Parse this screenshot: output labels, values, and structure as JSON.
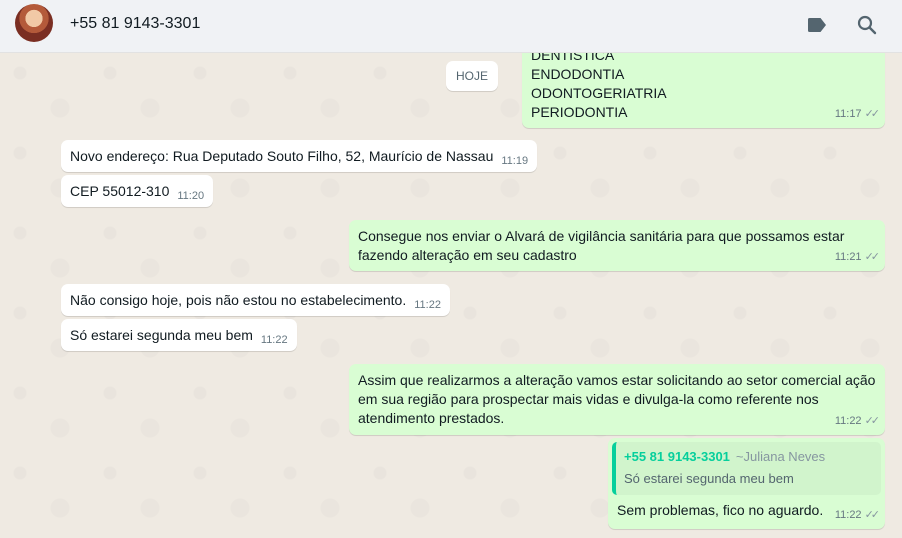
{
  "header": {
    "contact_name": "+55 81 9143-3301",
    "icons": [
      "label-icon",
      "search-icon"
    ]
  },
  "chat": {
    "day_separator": "HOJE",
    "messages": [
      {
        "dir": "out",
        "lines": [
          "DENTÍSTICA",
          "ENDODONTIA",
          "ODONTOGERIATRIA",
          "PERIODONTIA"
        ],
        "time": "11:17",
        "ticks": "✓✓"
      },
      {
        "dir": "in",
        "text": "Novo endereço: Rua Deputado Souto Filho, 52, Maurício de Nassau",
        "time": "11:19"
      },
      {
        "dir": "in",
        "text": "CEP 55012-310",
        "time": "11:20"
      },
      {
        "dir": "out",
        "text": "Consegue nos enviar o Alvará de vigilância sanitária para que possamos estar fazendo alteração em seu cadastro",
        "time": "11:21",
        "ticks": "✓✓"
      },
      {
        "dir": "in",
        "text": "Não consigo hoje, pois não estou no estabelecimento.",
        "time": "11:22"
      },
      {
        "dir": "in",
        "text": "Só estarei segunda meu bem",
        "time": "11:22"
      },
      {
        "dir": "out",
        "text": "Assim que realizarmos a alteração vamos estar solicitando ao setor comercial ação em sua região para prospectar mais vidas e divulga-la como referente nos atendimento prestados.",
        "time": "11:22",
        "ticks": "✓✓"
      },
      {
        "dir": "out",
        "quote": {
          "author": "+55 81 9143-3301",
          "name": "~Juliana Neves",
          "text": "Só estarei segunda meu bem"
        },
        "text": "Sem problemas, fico no aguardo.",
        "time": "11:22",
        "ticks": "✓✓"
      }
    ]
  },
  "colors": {
    "outgoing_bubble": "#d9fdd3",
    "incoming_bubble": "#ffffff",
    "quote_accent": "#06cf9c",
    "chat_background": "#efeae2"
  }
}
